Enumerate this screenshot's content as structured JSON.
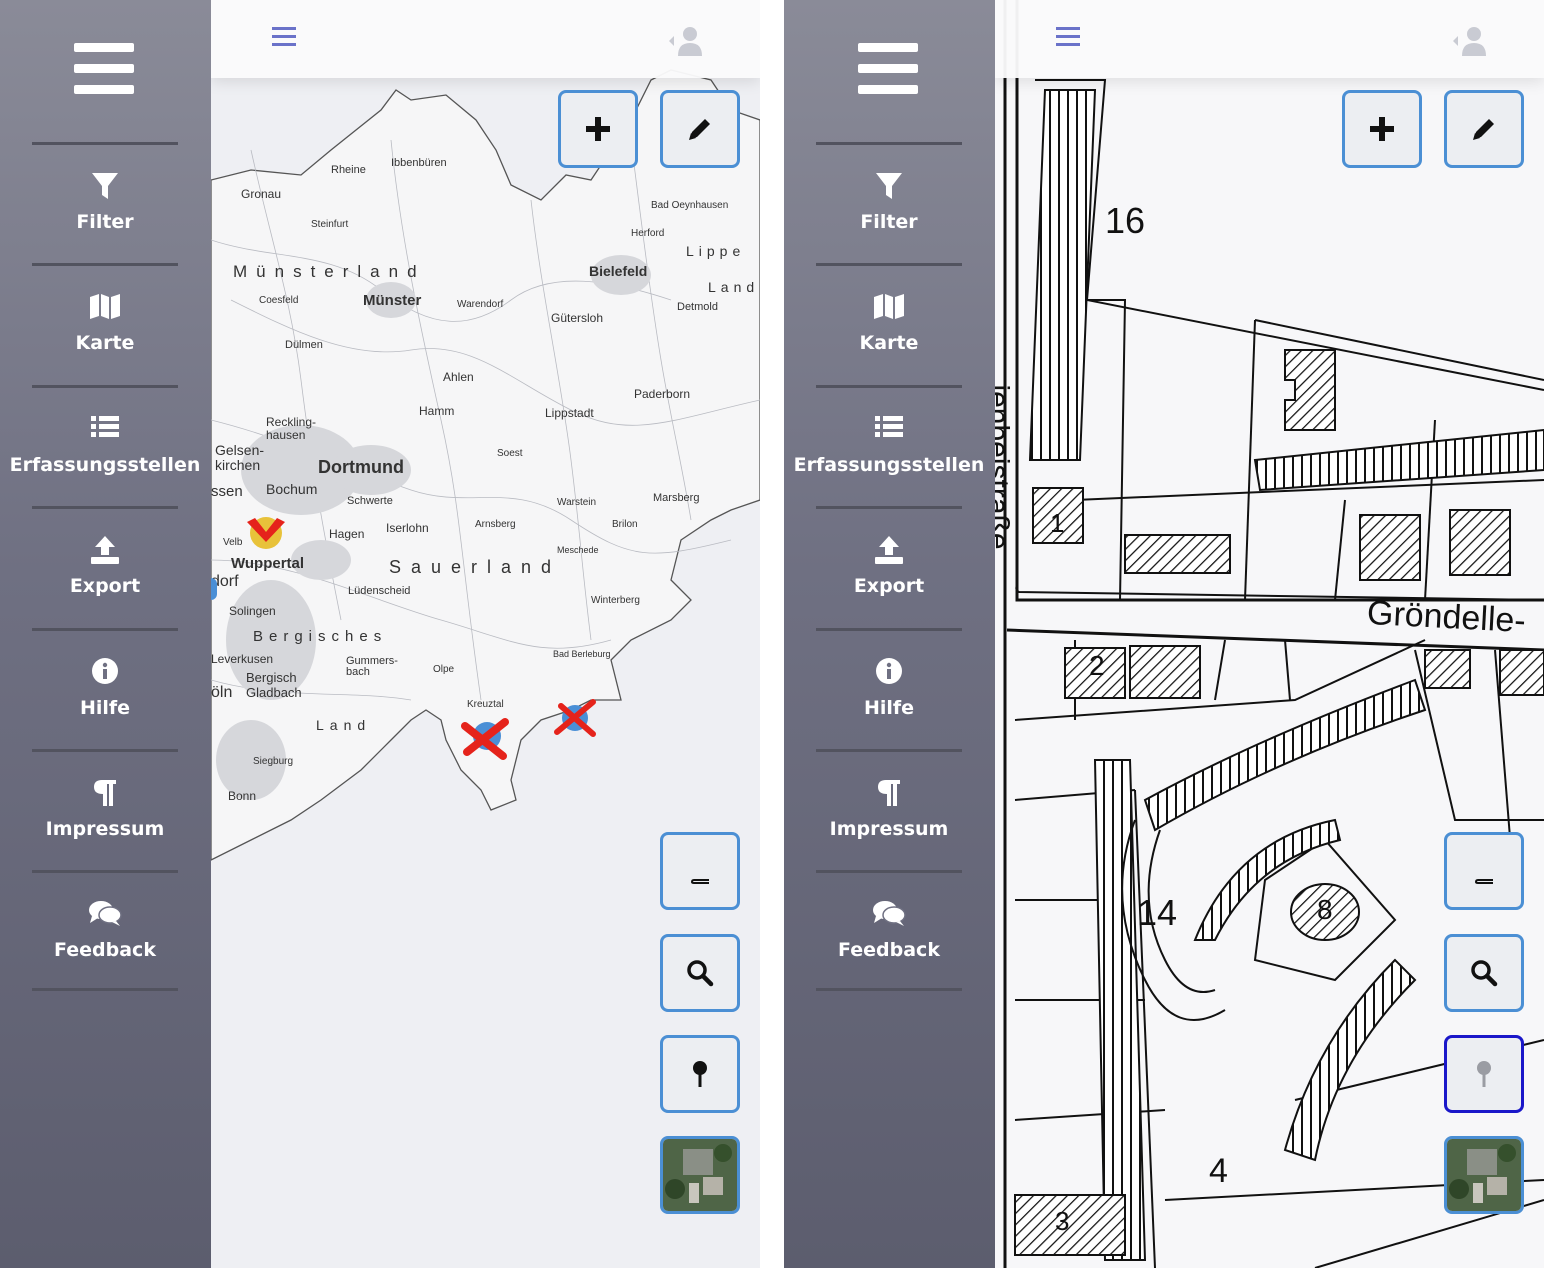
{
  "panels": [
    {
      "id": "left",
      "view": "regional-map",
      "sidebar": {
        "items": [
          {
            "label": "Filter",
            "icon": "filter-icon"
          },
          {
            "label": "Karte",
            "icon": "map-icon"
          },
          {
            "label": "Erfassungsstellen",
            "icon": "list-icon"
          },
          {
            "label": "Export",
            "icon": "upload-icon"
          },
          {
            "label": "Hilfe",
            "icon": "info-icon"
          },
          {
            "label": "Impressum",
            "icon": "paragraph-icon"
          },
          {
            "label": "Feedback",
            "icon": "comments-icon"
          }
        ]
      },
      "map_labels": {
        "ibbenbueren": "Ibbenbüren",
        "rheine": "Rheine",
        "gronau": "Gronau",
        "steinfurt": "Steinfurt",
        "bad_oeynhausen": "Bad Oeynhausen",
        "herford": "Herford",
        "lippe": "Lippe",
        "muensterland": "Münsterland",
        "bielefeld": "Bielefeld",
        "land": "Land",
        "coesfeld": "Coesfeld",
        "muenster": "Münster",
        "warendorf": "Warendorf",
        "guetersloh": "Gütersloh",
        "detmold": "Detmold",
        "duelmen": "Dülmen",
        "ahlen": "Ahlen",
        "paderborn": "Paderborn",
        "hamm": "Hamm",
        "lippstadt": "Lippstadt",
        "recklinghausen": "Reckling-hausen",
        "gelsenkirchen": "Gelsen-kirchen",
        "dortmund": "Dortmund",
        "soest": "Soest",
        "essen": "ssen",
        "bochum": "Bochum",
        "schwerte": "Schwerte",
        "warstein": "Warstein",
        "marsberg": "Marsberg",
        "hagen": "Hagen",
        "iserlohn": "Iserlohn",
        "arnsberg": "Arnsberg",
        "brilon": "Brilon",
        "meschede": "Meschede",
        "wuppertal": "Wuppertal",
        "sauerland": "Sauerland",
        "duesseldorf": "dorf",
        "luedenscheid": "Lüdenscheid",
        "winterberg": "Winterberg",
        "solingen": "Solingen",
        "bergisches": "Bergisches",
        "leverkusen": "Leverkusen",
        "gummersbach": "Gummers-bach",
        "olpe": "Olpe",
        "bad_berleburg": "Bad Berleburg",
        "koeln": "öln",
        "bergisch_gladbach": "Bergisch Gladbach",
        "kreuztal": "Kreuztal",
        "land2": "Land",
        "siegburg": "Siegburg",
        "bonn": "Bonn",
        "velbert": "Velb"
      }
    },
    {
      "id": "right",
      "view": "cadastral-map",
      "sidebar": {
        "items": [
          {
            "label": "Filter",
            "icon": "filter-icon"
          },
          {
            "label": "Karte",
            "icon": "map-icon"
          },
          {
            "label": "Erfassungsstellen",
            "icon": "list-icon"
          },
          {
            "label": "Export",
            "icon": "upload-icon"
          },
          {
            "label": "Hilfe",
            "icon": "info-icon"
          },
          {
            "label": "Impressum",
            "icon": "paragraph-icon"
          },
          {
            "label": "Feedback",
            "icon": "comments-icon"
          }
        ]
      },
      "map_labels": {
        "parcel_16": "16",
        "street_groendelle": "Gröndelle-",
        "street_left": "jenbeistraße",
        "parcel_14": "14",
        "parcel_4": "4",
        "parcel_8": "8",
        "parcel_2": "2",
        "parcel_1": "1",
        "parcel_3": "3"
      },
      "location_button_active": true
    }
  ],
  "colors": {
    "sidebar_top": "#8a8b98",
    "sidebar_bottom": "#5c5d6e",
    "button_border": "#4b8fd4",
    "button_active_border": "#1a17c9",
    "marker_red": "#e5231b",
    "marker_blue": "#4a8fd6",
    "marker_yellow": "#e8c23a",
    "toggle_icon": "#6a72c9"
  }
}
